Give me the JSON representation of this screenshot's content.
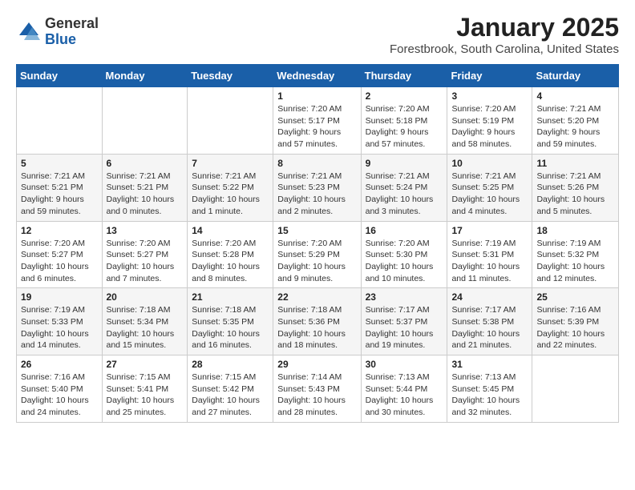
{
  "logo": {
    "general": "General",
    "blue": "Blue"
  },
  "title": "January 2025",
  "subtitle": "Forestbrook, South Carolina, United States",
  "weekdays": [
    "Sunday",
    "Monday",
    "Tuesday",
    "Wednesday",
    "Thursday",
    "Friday",
    "Saturday"
  ],
  "weeks": [
    [
      {
        "day": "",
        "info": ""
      },
      {
        "day": "",
        "info": ""
      },
      {
        "day": "",
        "info": ""
      },
      {
        "day": "1",
        "info": "Sunrise: 7:20 AM\nSunset: 5:17 PM\nDaylight: 9 hours and 57 minutes."
      },
      {
        "day": "2",
        "info": "Sunrise: 7:20 AM\nSunset: 5:18 PM\nDaylight: 9 hours and 57 minutes."
      },
      {
        "day": "3",
        "info": "Sunrise: 7:20 AM\nSunset: 5:19 PM\nDaylight: 9 hours and 58 minutes."
      },
      {
        "day": "4",
        "info": "Sunrise: 7:21 AM\nSunset: 5:20 PM\nDaylight: 9 hours and 59 minutes."
      }
    ],
    [
      {
        "day": "5",
        "info": "Sunrise: 7:21 AM\nSunset: 5:21 PM\nDaylight: 9 hours and 59 minutes."
      },
      {
        "day": "6",
        "info": "Sunrise: 7:21 AM\nSunset: 5:21 PM\nDaylight: 10 hours and 0 minutes."
      },
      {
        "day": "7",
        "info": "Sunrise: 7:21 AM\nSunset: 5:22 PM\nDaylight: 10 hours and 1 minute."
      },
      {
        "day": "8",
        "info": "Sunrise: 7:21 AM\nSunset: 5:23 PM\nDaylight: 10 hours and 2 minutes."
      },
      {
        "day": "9",
        "info": "Sunrise: 7:21 AM\nSunset: 5:24 PM\nDaylight: 10 hours and 3 minutes."
      },
      {
        "day": "10",
        "info": "Sunrise: 7:21 AM\nSunset: 5:25 PM\nDaylight: 10 hours and 4 minutes."
      },
      {
        "day": "11",
        "info": "Sunrise: 7:21 AM\nSunset: 5:26 PM\nDaylight: 10 hours and 5 minutes."
      }
    ],
    [
      {
        "day": "12",
        "info": "Sunrise: 7:20 AM\nSunset: 5:27 PM\nDaylight: 10 hours and 6 minutes."
      },
      {
        "day": "13",
        "info": "Sunrise: 7:20 AM\nSunset: 5:27 PM\nDaylight: 10 hours and 7 minutes."
      },
      {
        "day": "14",
        "info": "Sunrise: 7:20 AM\nSunset: 5:28 PM\nDaylight: 10 hours and 8 minutes."
      },
      {
        "day": "15",
        "info": "Sunrise: 7:20 AM\nSunset: 5:29 PM\nDaylight: 10 hours and 9 minutes."
      },
      {
        "day": "16",
        "info": "Sunrise: 7:20 AM\nSunset: 5:30 PM\nDaylight: 10 hours and 10 minutes."
      },
      {
        "day": "17",
        "info": "Sunrise: 7:19 AM\nSunset: 5:31 PM\nDaylight: 10 hours and 11 minutes."
      },
      {
        "day": "18",
        "info": "Sunrise: 7:19 AM\nSunset: 5:32 PM\nDaylight: 10 hours and 12 minutes."
      }
    ],
    [
      {
        "day": "19",
        "info": "Sunrise: 7:19 AM\nSunset: 5:33 PM\nDaylight: 10 hours and 14 minutes."
      },
      {
        "day": "20",
        "info": "Sunrise: 7:18 AM\nSunset: 5:34 PM\nDaylight: 10 hours and 15 minutes."
      },
      {
        "day": "21",
        "info": "Sunrise: 7:18 AM\nSunset: 5:35 PM\nDaylight: 10 hours and 16 minutes."
      },
      {
        "day": "22",
        "info": "Sunrise: 7:18 AM\nSunset: 5:36 PM\nDaylight: 10 hours and 18 minutes."
      },
      {
        "day": "23",
        "info": "Sunrise: 7:17 AM\nSunset: 5:37 PM\nDaylight: 10 hours and 19 minutes."
      },
      {
        "day": "24",
        "info": "Sunrise: 7:17 AM\nSunset: 5:38 PM\nDaylight: 10 hours and 21 minutes."
      },
      {
        "day": "25",
        "info": "Sunrise: 7:16 AM\nSunset: 5:39 PM\nDaylight: 10 hours and 22 minutes."
      }
    ],
    [
      {
        "day": "26",
        "info": "Sunrise: 7:16 AM\nSunset: 5:40 PM\nDaylight: 10 hours and 24 minutes."
      },
      {
        "day": "27",
        "info": "Sunrise: 7:15 AM\nSunset: 5:41 PM\nDaylight: 10 hours and 25 minutes."
      },
      {
        "day": "28",
        "info": "Sunrise: 7:15 AM\nSunset: 5:42 PM\nDaylight: 10 hours and 27 minutes."
      },
      {
        "day": "29",
        "info": "Sunrise: 7:14 AM\nSunset: 5:43 PM\nDaylight: 10 hours and 28 minutes."
      },
      {
        "day": "30",
        "info": "Sunrise: 7:13 AM\nSunset: 5:44 PM\nDaylight: 10 hours and 30 minutes."
      },
      {
        "day": "31",
        "info": "Sunrise: 7:13 AM\nSunset: 5:45 PM\nDaylight: 10 hours and 32 minutes."
      },
      {
        "day": "",
        "info": ""
      }
    ]
  ]
}
